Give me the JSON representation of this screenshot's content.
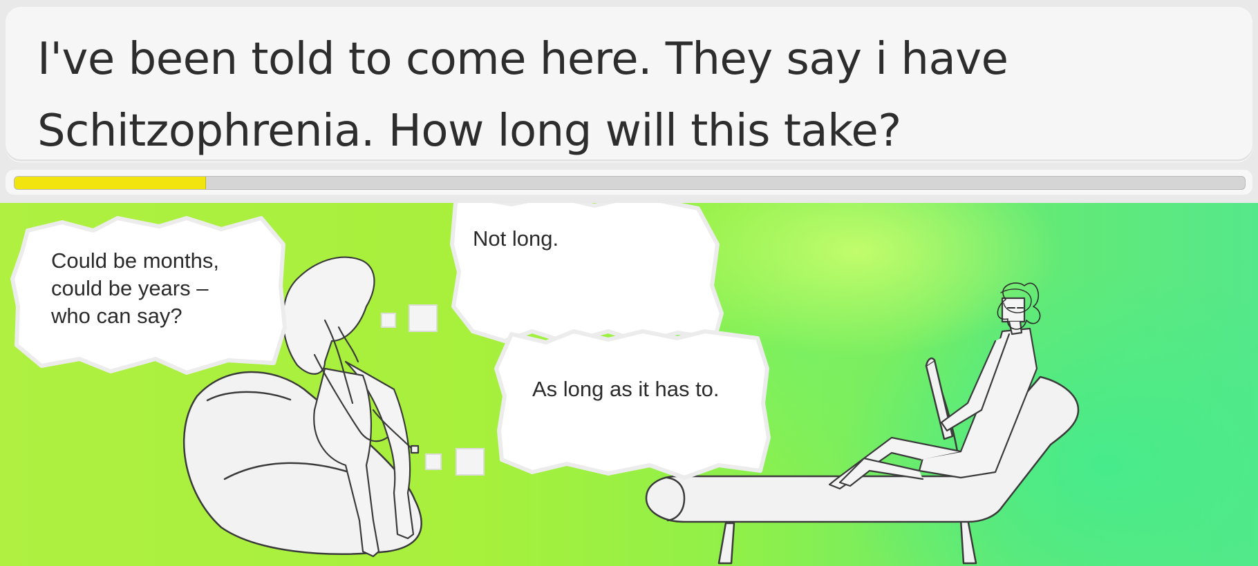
{
  "dialogue": {
    "line1": "I've been told to come here. They say i have",
    "line2": "Schitzophrenia. How long will this take?"
  },
  "progress": {
    "fraction": 0.155,
    "fill_color": "#f1e40f"
  },
  "choices": [
    {
      "id": "choice-1",
      "text_lines": [
        "Could be months,",
        "could be years –",
        "who can say?"
      ]
    },
    {
      "id": "choice-2",
      "text_lines": [
        "Not long."
      ]
    },
    {
      "id": "choice-3",
      "text_lines": [
        "As long as it has to."
      ]
    }
  ],
  "scene": {
    "characters": [
      "therapist",
      "patient"
    ],
    "furniture": [
      "bean-bag-chair",
      "chaise-longue"
    ]
  }
}
